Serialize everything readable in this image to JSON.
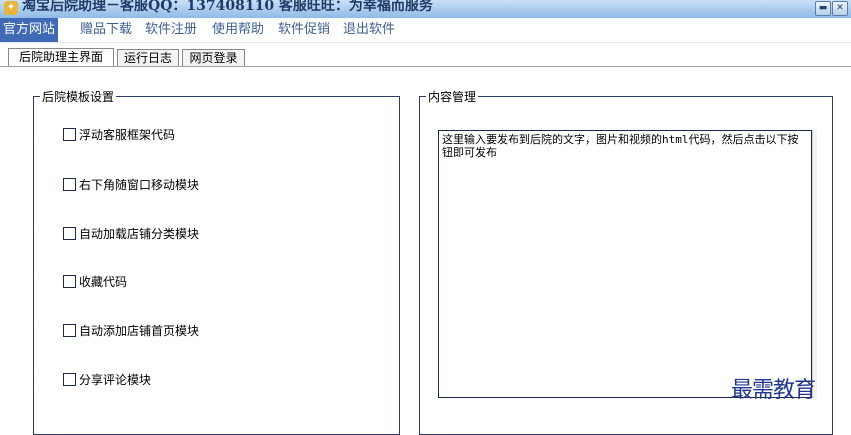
{
  "window": {
    "title": "淘宝后院助理－客服QQ：137408110 客服旺旺：为幸福而服务",
    "app_icon_glyph": "✦",
    "minimize_glyph": "▬",
    "close_glyph": "✕"
  },
  "menu": {
    "items": [
      {
        "label": "官方网站",
        "active": true
      },
      {
        "label": "赠品下载"
      },
      {
        "label": "软件注册"
      },
      {
        "label": "使用帮助"
      },
      {
        "label": "软件促销"
      },
      {
        "label": "退出软件"
      }
    ]
  },
  "tabs": [
    {
      "label": "后院助理主界面",
      "active": true
    },
    {
      "label": "运行日志"
    },
    {
      "label": "网页登录"
    }
  ],
  "template_settings": {
    "legend": "后院模板设置",
    "options": [
      {
        "label": "浮动客服框架代码",
        "checked": false
      },
      {
        "label": "右下角随窗口移动模块",
        "checked": false
      },
      {
        "label": "自动加载店铺分类模块",
        "checked": false
      },
      {
        "label": "收藏代码",
        "checked": false
      },
      {
        "label": "自动添加店铺首页模块",
        "checked": false
      },
      {
        "label": "分享评论模块",
        "checked": false
      }
    ]
  },
  "content_management": {
    "legend": "内容管理",
    "text_value": "这里输入要发布到后院的文字，图片和视频的html代码，然后点击以下按钮即可发布"
  },
  "watermark": "最需教育",
  "colors": {
    "title_bar_top": "#c9e0f7",
    "title_bar_bottom": "#8fbbe8",
    "menu_text": "#3e5f95",
    "menu_active_bg": "#3f6ab6",
    "group_border": "#2f3a68"
  }
}
